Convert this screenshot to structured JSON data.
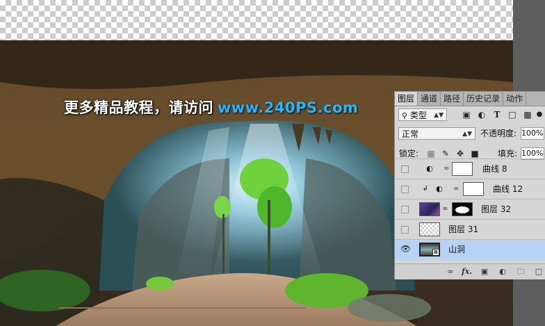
{
  "watermark": {
    "text_cn": "更多精品教程，请访问",
    "url": "www.240PS.com"
  },
  "panel": {
    "tabs": [
      "图层",
      "通道",
      "路径",
      "历史记录",
      "动作"
    ],
    "filter": {
      "label": "类型",
      "icon": "search-icon"
    },
    "filter_icons": [
      "image-filter-icon",
      "adjustment-filter-icon",
      "type-filter-icon",
      "shape-filter-icon",
      "smart-object-filter-icon"
    ],
    "blend_mode": "正常",
    "opacity": {
      "label": "不透明度:",
      "value": "100%"
    },
    "lock": {
      "label": "锁定:",
      "icons": [
        "lock-transparent-icon",
        "lock-image-icon",
        "lock-position-icon",
        "lock-all-icon"
      ]
    },
    "fill": {
      "label": "填充:",
      "value": "100%"
    },
    "layers": [
      {
        "name": "曲线 8",
        "visible": false,
        "selected": false,
        "type": "adjustment"
      },
      {
        "name": "曲线 12",
        "visible": false,
        "selected": false,
        "type": "adjustment",
        "clipped": true
      },
      {
        "name": "图层 32",
        "visible": false,
        "selected": false,
        "type": "image-with-mask"
      },
      {
        "name": "图层 31",
        "visible": false,
        "selected": false,
        "type": "empty"
      },
      {
        "name": "山洞",
        "visible": true,
        "selected": true,
        "type": "smart-object"
      }
    ],
    "footer_icons": [
      "link-layers-icon",
      "fx-icon",
      "add-mask-icon",
      "new-adjustment-icon",
      "new-group-icon",
      "new-layer-icon"
    ],
    "footer_labels": {
      "link": "∞",
      "fx": "fx."
    }
  }
}
